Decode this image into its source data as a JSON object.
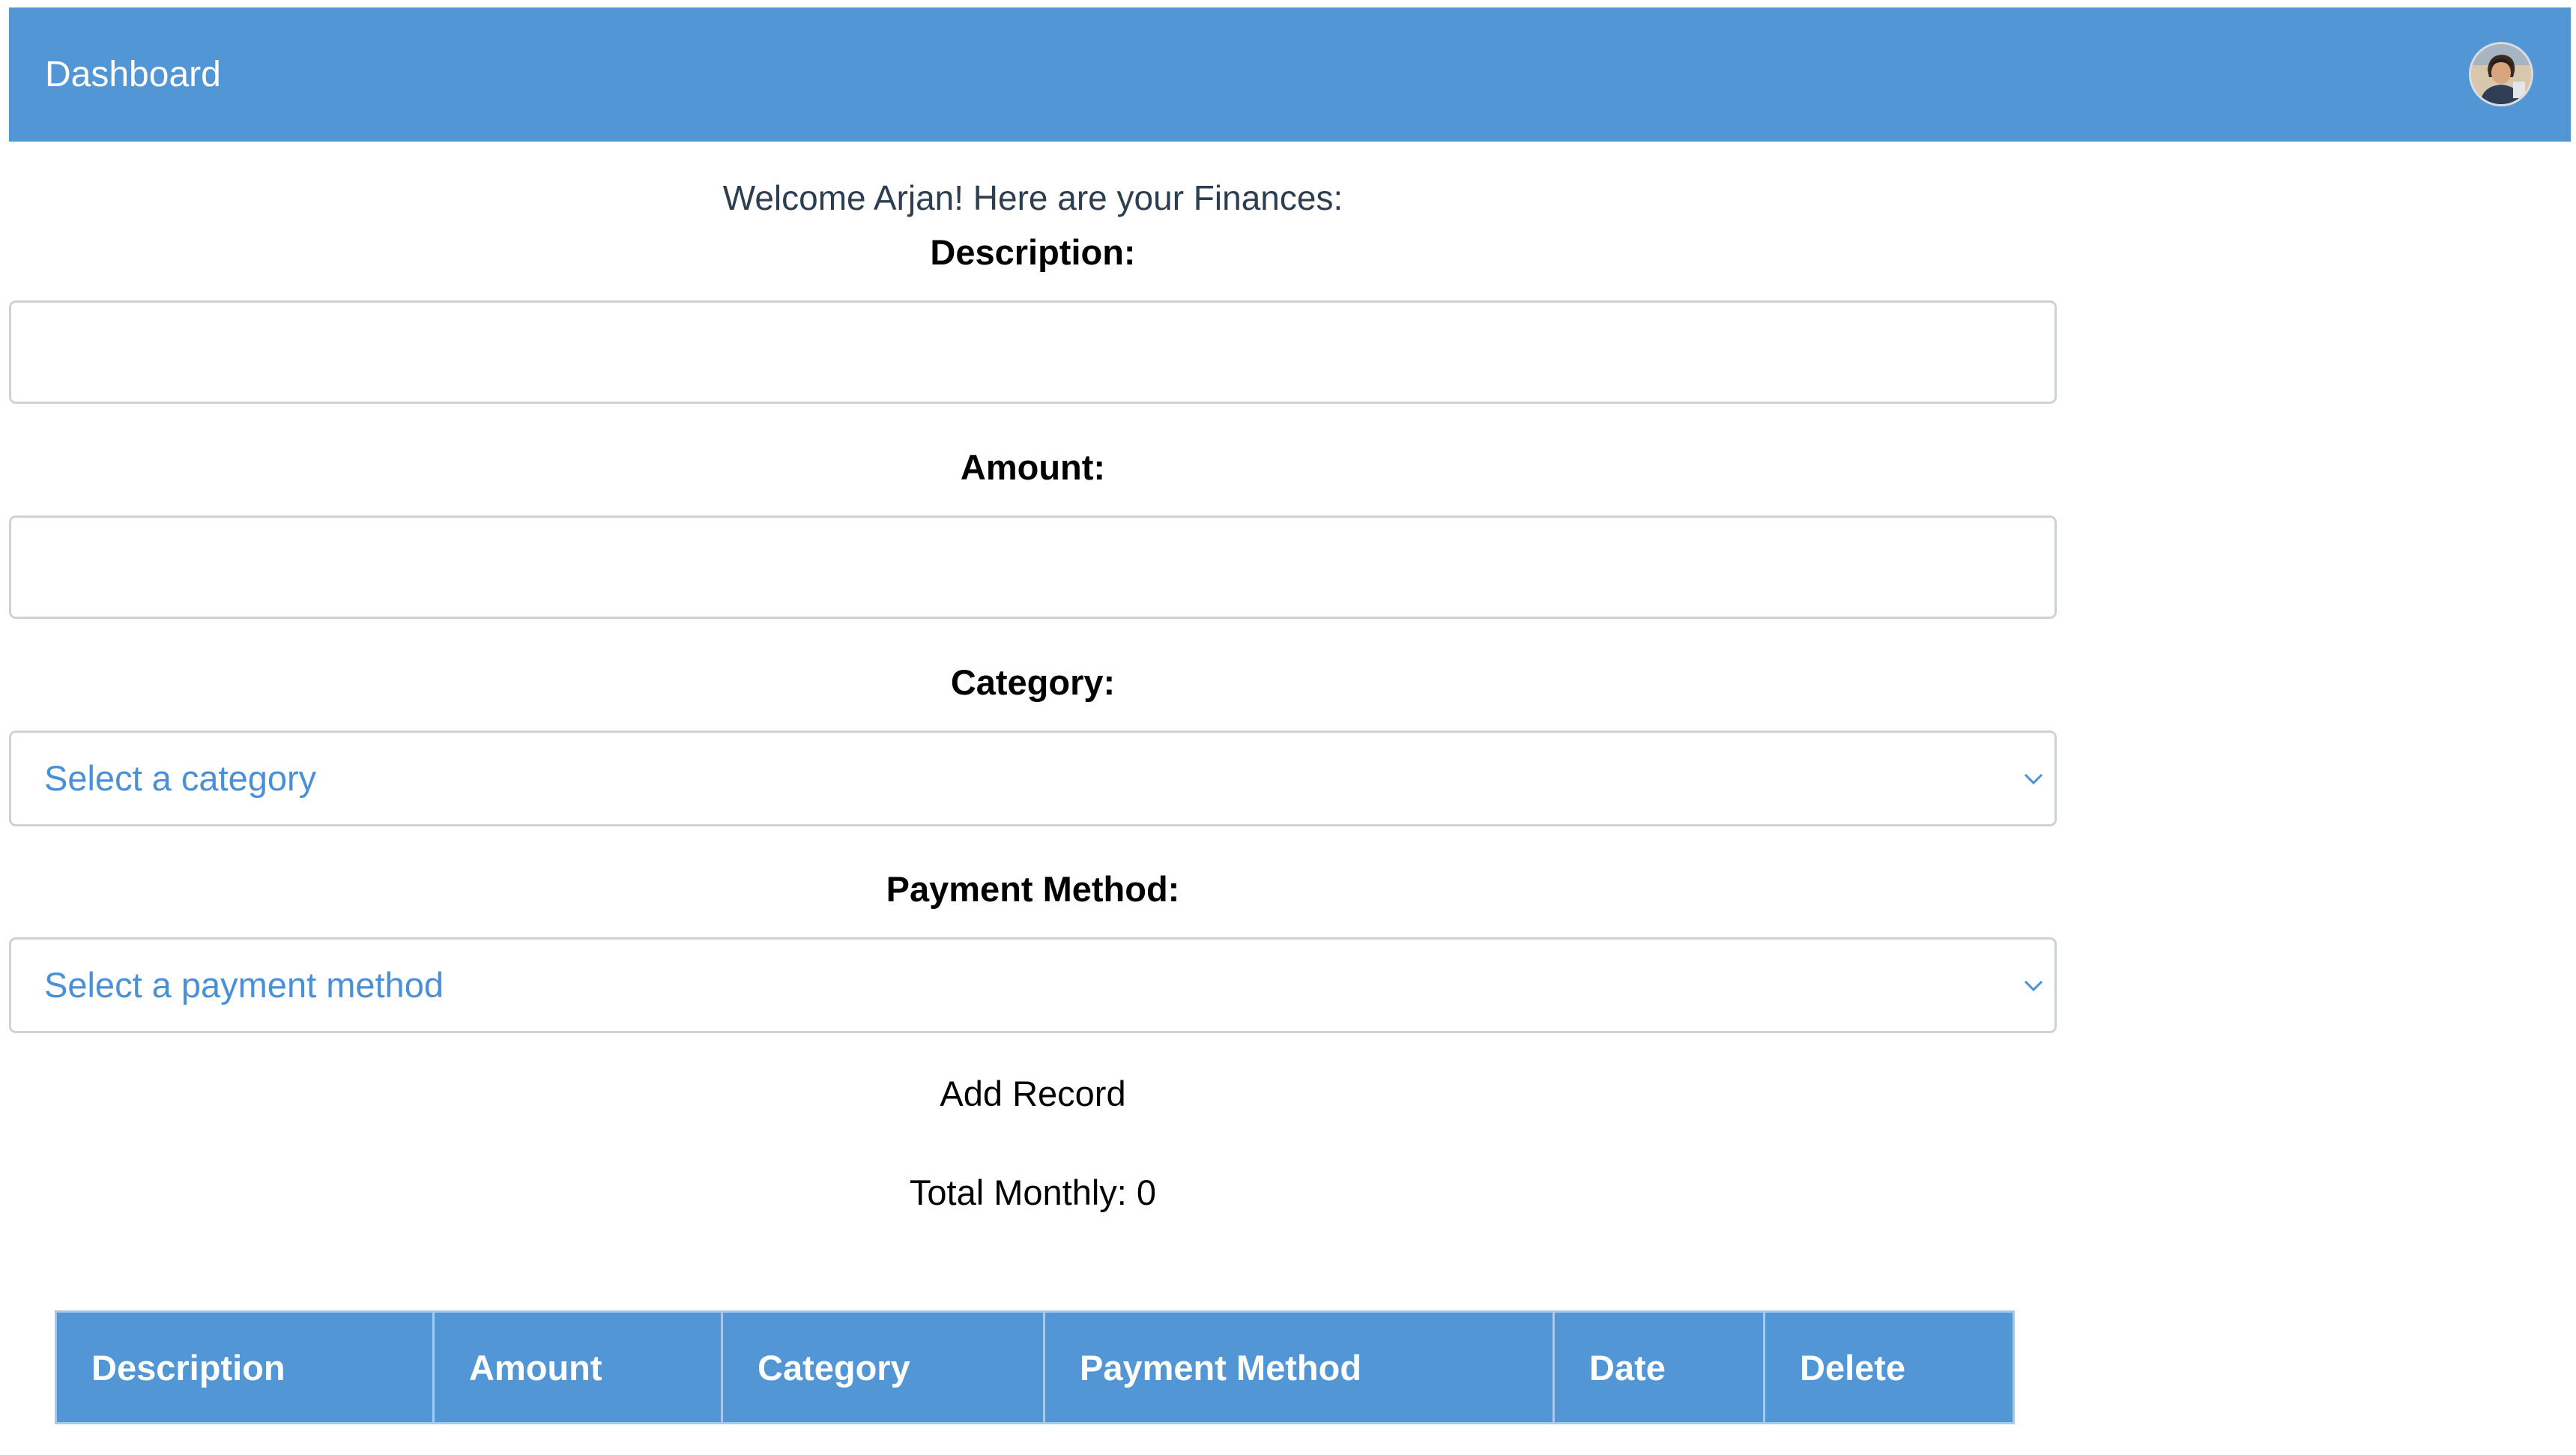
{
  "navbar": {
    "brand": "Dashboard",
    "avatar_icon": "user-avatar-icon",
    "background": "#5296d5"
  },
  "welcome_message": "Welcome Arjan! Here are your Finances:",
  "form": {
    "description_label": "Description:",
    "description_value": "",
    "amount_label": "Amount:",
    "amount_value": "",
    "category_label": "Category:",
    "category_placeholder": "Select a category",
    "payment_label": "Payment Method:",
    "payment_placeholder": "Select a payment method",
    "add_button": "Add Record"
  },
  "total_monthly": "Total Monthly: 0",
  "table": {
    "headers": [
      "Description",
      "Amount",
      "Category",
      "Payment Method",
      "Date",
      "Delete"
    ],
    "rows": []
  },
  "colors": {
    "accent": "#5296d5",
    "select_text": "#4a90d9",
    "welcome_text": "#2c3e50"
  }
}
